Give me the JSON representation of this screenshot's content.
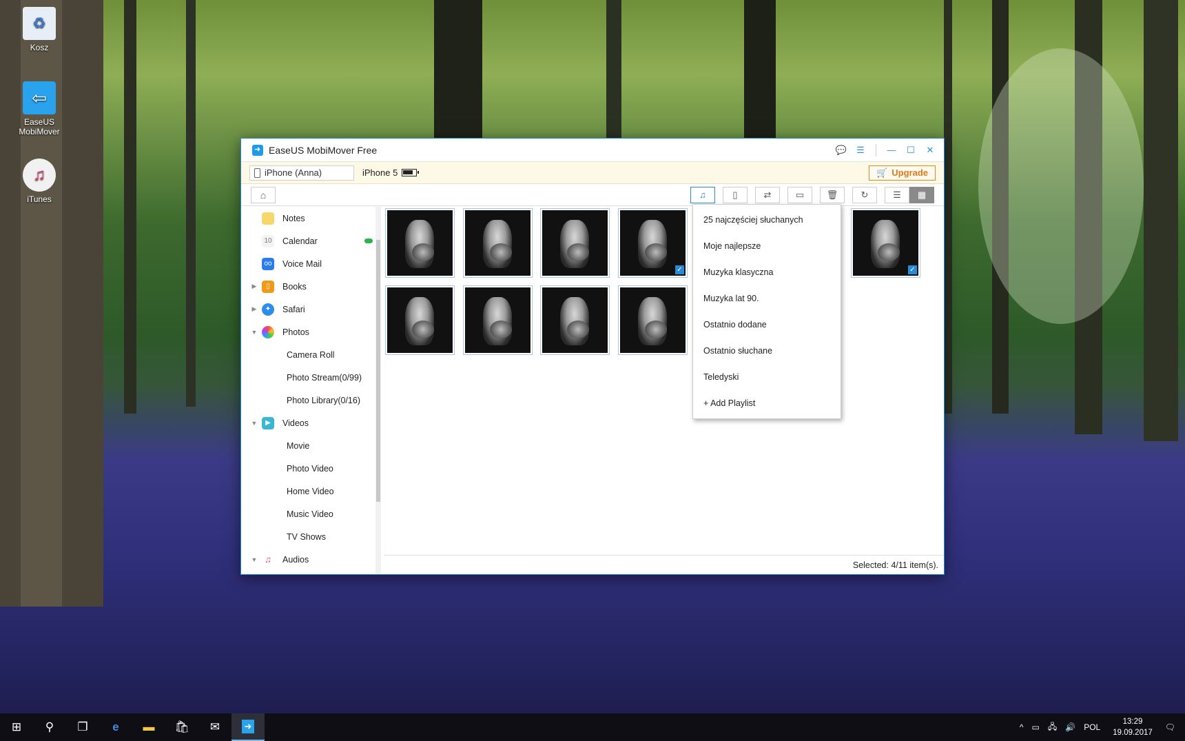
{
  "desktop": {
    "icons": [
      {
        "label": "Kosz"
      },
      {
        "label": "EaseUS MobiMover"
      },
      {
        "label": "iTunes"
      }
    ]
  },
  "window": {
    "title": "EaseUS MobiMover Free",
    "device_name": "iPhone (Anna)",
    "device_model": "iPhone 5",
    "upgrade_label": "Upgrade"
  },
  "sidebar": {
    "items": [
      {
        "label": "Notes",
        "icon": "notes-icon"
      },
      {
        "label": "Calendar",
        "icon": "calendar-icon",
        "badge": "10"
      },
      {
        "label": "Voice Mail",
        "icon": "voicemail-icon"
      },
      {
        "label": "Books",
        "icon": "books-icon"
      },
      {
        "label": "Safari",
        "icon": "safari-icon"
      },
      {
        "label": "Photos",
        "icon": "photos-icon"
      },
      {
        "label": "Camera Roll"
      },
      {
        "label": "Photo Stream(0/99)"
      },
      {
        "label": "Photo Library(0/16)"
      },
      {
        "label": "Videos",
        "icon": "videos-icon"
      },
      {
        "label": "Movie"
      },
      {
        "label": "Photo Video"
      },
      {
        "label": "Home Video"
      },
      {
        "label": "Music Video"
      },
      {
        "label": "TV Shows"
      },
      {
        "label": "Audios",
        "icon": "audios-icon"
      }
    ]
  },
  "dropdown": {
    "items": [
      {
        "label": "25 najczęściej słuchanych"
      },
      {
        "label": "Moje najlepsze"
      },
      {
        "label": "Muzyka klasyczna"
      },
      {
        "label": "Muzyka lat 90."
      },
      {
        "label": "Ostatnio dodane"
      },
      {
        "label": "Ostatnio słuchane"
      },
      {
        "label": "Teledyski"
      },
      {
        "label": "+ Add Playlist"
      }
    ]
  },
  "grid": {
    "items": [
      {
        "checked": false
      },
      {
        "checked": false
      },
      {
        "checked": false
      },
      {
        "checked": true
      },
      {
        "checked": true
      },
      {
        "checked": true
      },
      {
        "checked": false
      },
      {
        "checked": false
      },
      {
        "checked": false
      },
      {
        "checked": false
      }
    ]
  },
  "status": {
    "selected": "Selected: 4/11 item(s)."
  },
  "taskbar": {
    "lang": "POL",
    "time": "13:29",
    "date": "19.09.2017"
  }
}
